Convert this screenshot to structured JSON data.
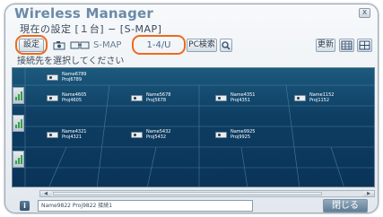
{
  "window": {
    "title": "Wireless Manager",
    "close_glyph": "x",
    "subtitle": "現在の設定 [１台] − [S-MAP]"
  },
  "toolbar": {
    "settings_label": "設定",
    "camera_icon": "camera-icon",
    "transfer_icon": "transfer-icon",
    "mode_label": "S-MAP",
    "page_label": "1-4/U",
    "search_label": "PC検索",
    "search_icon": "magnifier-icon",
    "refresh_label": "更新",
    "view_icon_1": "view-grid-icon",
    "view_icon_2": "view-list-icon"
  },
  "instruction": "接続先を選択してください",
  "devices": [
    {
      "name": "Name6789",
      "product": "Proj6789"
    },
    {
      "name": "Name4605",
      "product": "Proj4605"
    },
    {
      "name": "Name5678",
      "product": "Proj5678"
    },
    {
      "name": "Name4351",
      "product": "Proj4351"
    },
    {
      "name": "Name1152",
      "product": "Proj1152"
    },
    {
      "name": "Name4321",
      "product": "Proj4321"
    },
    {
      "name": "Name5432",
      "product": "Proj5432"
    },
    {
      "name": "Name9925",
      "product": "Proj9925"
    }
  ],
  "status": {
    "info_glyph": "i",
    "text": "Name9822 Proj9822 接続1",
    "close_label": "閉じる"
  },
  "colors": {
    "accent_highlight": "#ee6a1c",
    "grid_background": "#0e3e63",
    "title_color": "#6a8aa8"
  }
}
